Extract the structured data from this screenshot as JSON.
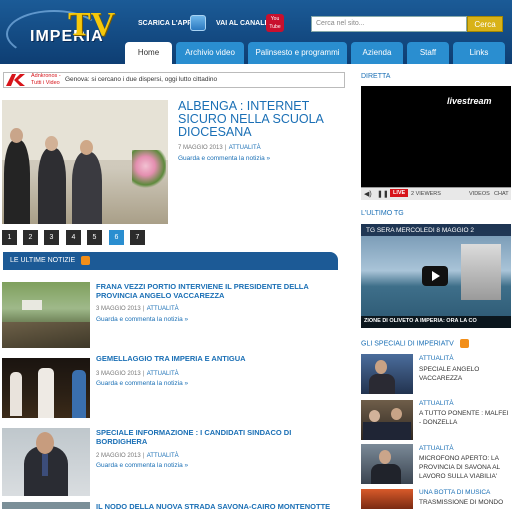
{
  "header": {
    "logo_text": "IMPERIA",
    "logo_tv": "TV",
    "app_label": "SCARICA L'APP",
    "channel_label": "VAI AL CANALE",
    "youtube_icon_text": "You Tube",
    "search_placeholder": "Cerca nel sito...",
    "search_button": "Cerca"
  },
  "nav": {
    "tabs": [
      "Home",
      "Archivio video",
      "Palinsesto e programmi",
      "Azienda",
      "Staff",
      "Links"
    ],
    "active": "Home"
  },
  "breaking": {
    "source": "Adnkronos - Tutti i Video",
    "text": "Genova: si cercano i due dispersi, oggi lutto cittadino"
  },
  "featured": {
    "title": "ALBENGA : INTERNET SICURO NELLA SCUOLA DIOCESANA",
    "date": "7 MAGGIO 2013",
    "separator": "|",
    "category": "ATTUALITÀ",
    "link": "Guarda e commenta la notizia »"
  },
  "pagination": [
    "1",
    "2",
    "3",
    "4",
    "5",
    "6",
    "7"
  ],
  "pagination_active": "6",
  "news": {
    "header": "LE ULTIME NOTIZIE",
    "items": [
      {
        "title": "FRANA VEZZI PORTIO INTERVIENE IL PRESIDENTE DELLA PROVINCIA ANGELO VACCAREZZA",
        "date": "3 MAGGIO 2013",
        "category": "ATTUALITÀ",
        "link": "Guarda e commenta la notizia »"
      },
      {
        "title": "GEMELLAGGIO TRA IMPERIA E ANTIGUA",
        "date": "3 MAGGIO 2013",
        "category": "ATTUALITÀ",
        "link": "Guarda e commenta la notizia »"
      },
      {
        "title": "SPECIALE INFORMAZIONE : I CANDIDATI SINDACO DI BORDIGHERA",
        "date": "2 MAGGIO 2013",
        "category": "ATTUALITÀ",
        "link": "Guarda e commenta la notizia »"
      },
      {
        "title": "IL NODO DELLA NUOVA STRADA SAVONA-CAIRO MONTENOTTE"
      }
    ]
  },
  "sidebar": {
    "live_title": "DIRETTA",
    "live_brand": "livestream",
    "live_badge": "LIVE",
    "viewers": "2 VIEWERS",
    "videos_label": "VIDEOS",
    "chat_label": "CHAT",
    "tg_title": "L'ULTIMO TG",
    "tg_caption": "TG SERA MERCOLEDI 8 MAGGIO 2",
    "tg_ticker": "ZIONE DI OLIVETO A IMPERIA: ORA LA CO",
    "specials_title": "GLI SPECIALI DI IMPERIATV",
    "specials": [
      {
        "category": "ATTUALITÀ",
        "title": "SPECIALE ANGELO VACCAREZZA"
      },
      {
        "category": "ATTUALITÀ",
        "title": "A TUTTO PONENTE : MALFEI - DONZELLA"
      },
      {
        "category": "ATTUALITÀ",
        "title": "MICROFONO APERTO: LA PROVINCIA DI SAVONA AL LAVORO SULLA VIABILIA'"
      },
      {
        "category": "UNA BOTTA DI MUSICA",
        "title": "TRASMISSIONE DI MONDO"
      }
    ]
  },
  "colors": {
    "header_blue": "#1b5b97",
    "accent_blue": "#2a8ed0",
    "link_blue": "#1a6fb5",
    "search_button": "#d8b218",
    "breaking_red": "#d7141a"
  }
}
